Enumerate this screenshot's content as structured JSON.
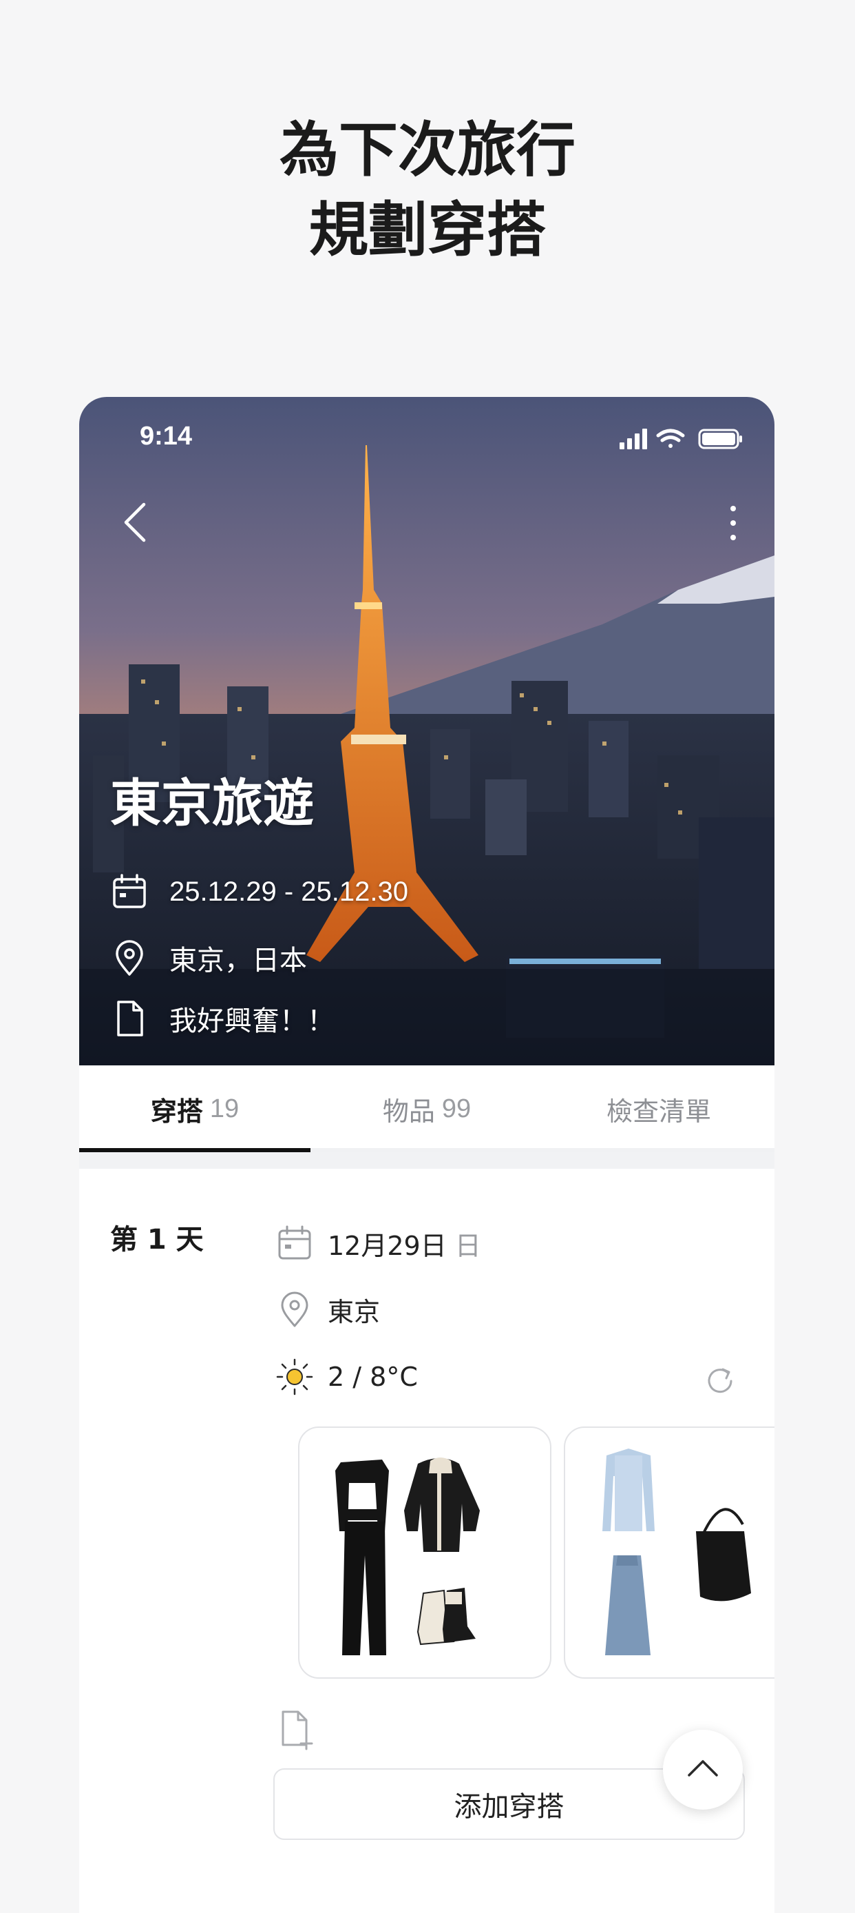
{
  "headline": {
    "line1": "為下次旅行",
    "line2": "規劃穿搭"
  },
  "status_bar": {
    "time": "9:14"
  },
  "trip": {
    "title": "東京旅遊",
    "dates": "25.12.29 - 25.12.30",
    "location": "東京，日本",
    "note": "我好興奮！！"
  },
  "tabs": [
    {
      "label": "穿搭",
      "count": "19"
    },
    {
      "label": "物品",
      "count": "99"
    },
    {
      "label": "檢查清單",
      "count": ""
    }
  ],
  "day": {
    "label": "第 1 天",
    "date": "12月29日",
    "weekday": "日",
    "place": "東京",
    "weather": "2 / 8°C"
  },
  "actions": {
    "add_outfit": "添加穿搭"
  },
  "icons": [
    "back-arrow-icon",
    "more-icon",
    "calendar-icon",
    "location-pin-icon",
    "note-icon",
    "sun-icon",
    "refresh-icon",
    "add-note-icon",
    "chevron-up-icon",
    "signal-icon",
    "wifi-icon",
    "battery-icon"
  ]
}
